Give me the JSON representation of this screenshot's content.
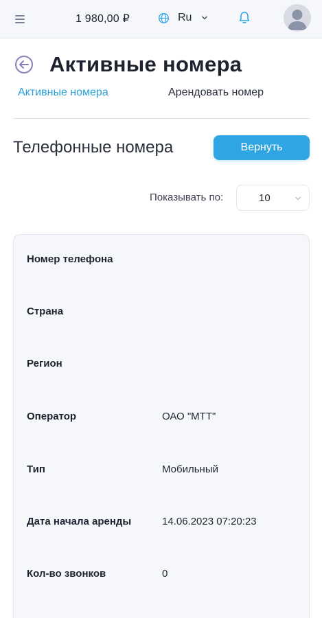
{
  "header": {
    "balance": "1 980,00 ₽",
    "language": "Ru",
    "icons": {
      "menu": "menu-icon",
      "globe": "globe-icon",
      "chevron": "chevron-down-icon",
      "bell": "bell-icon",
      "avatar": "user-avatar-icon"
    }
  },
  "page": {
    "title": "Активные номера",
    "back_icon": "back-arrow-icon"
  },
  "tabs": [
    {
      "label": "Активные номера",
      "active": true
    },
    {
      "label": "Арендовать номер",
      "active": false
    }
  ],
  "section": {
    "title": "Телефонные номера",
    "return_button": "Вернуть"
  },
  "pagination": {
    "label": "Показывать по:",
    "value": "10"
  },
  "details": [
    {
      "label": "Номер телефона",
      "value": ""
    },
    {
      "label": "Страна",
      "value": ""
    },
    {
      "label": "Регион",
      "value": ""
    },
    {
      "label": "Оператор",
      "value": "ОАО \"МТТ\""
    },
    {
      "label": "Тип",
      "value": "Мобильный"
    },
    {
      "label": "Дата начала аренды",
      "value": "14.06.2023 07:20:23"
    },
    {
      "label": "Кол-во звонков",
      "value": "0"
    }
  ],
  "colors": {
    "accent": "#2fa6e3",
    "active_tab": "#2a9fd8",
    "card_bg": "#f6f7fb",
    "topbar_bg": "#f6f7fb"
  }
}
